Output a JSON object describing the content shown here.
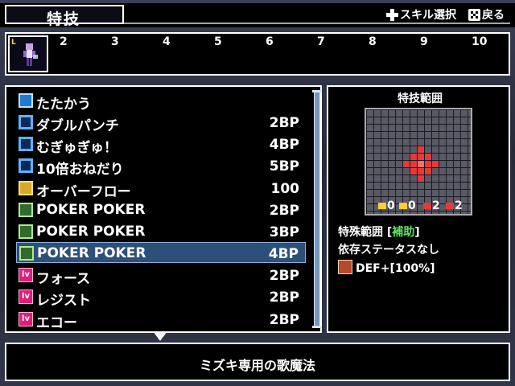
{
  "header": {
    "title": "特技",
    "hint_skill_select": "スキル選択",
    "hint_back": "戻る"
  },
  "party": {
    "slot_numbers": [
      "2",
      "3",
      "4",
      "5",
      "6",
      "7",
      "8",
      "9",
      "10"
    ]
  },
  "skills": [
    {
      "name": "たたかう",
      "cost": "",
      "icon": "slash-icon"
    },
    {
      "name": "ダブルパンチ",
      "cost": "2BP",
      "icon": "blue-square-icon"
    },
    {
      "name": "むぎゅぎゅ！",
      "cost": "4BP",
      "icon": "blue-square-icon"
    },
    {
      "name": "10倍おねだり",
      "cost": "5BP",
      "icon": "blue-square-icon"
    },
    {
      "name": "オーバーフロー",
      "cost": "100",
      "icon": "gold-burst-icon"
    },
    {
      "name": "POKER POKER",
      "cost": "2BP",
      "icon": "music-note-icon"
    },
    {
      "name": "POKER POKER",
      "cost": "3BP",
      "icon": "music-note-plus-icon"
    },
    {
      "name": "POKER POKER",
      "cost": "4BP",
      "icon": "music-note-plus2-icon"
    },
    {
      "name": "フォース",
      "cost": "2BP",
      "icon": "lv-icon"
    },
    {
      "name": "レジスト",
      "cost": "2BP",
      "icon": "lv-icon"
    },
    {
      "name": "エコー",
      "cost": "2BP",
      "icon": "lv-icon"
    }
  ],
  "selected_index": 7,
  "range_panel": {
    "title": "特技範囲",
    "stats": [
      "0",
      "0",
      "2",
      "2"
    ],
    "special_label": "特殊範囲",
    "special_value": "補助",
    "dependency": "依存ステータスなし",
    "buff": "DEF+[100%]"
  },
  "description": "ミズキ専用の歌魔法",
  "colors": {
    "highlight": "#2d5078",
    "range_red": "#e53a3a",
    "lv_pink": "#e11d7a",
    "support_green": "#5fe35f"
  }
}
